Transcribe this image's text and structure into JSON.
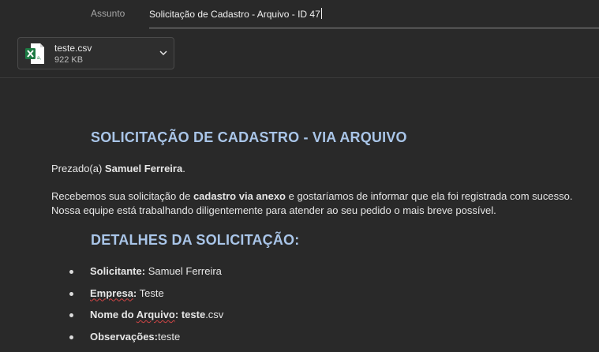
{
  "header": {
    "subject_label": "Assunto",
    "subject_value": "Solicitação de Cadastro - Arquivo - ID 47"
  },
  "attachment": {
    "name": "teste.csv",
    "size": "922 KB",
    "icon": "excel-csv-icon"
  },
  "email": {
    "title": "SOLICITAÇÃO DE CADASTRO - VIA ARQUIVO",
    "greeting_prefix": "Prezado(a) ",
    "greeting_name": "Samuel Ferreira",
    "greeting_suffix": ".",
    "body_line1_a": "Recebemos sua solicitação de ",
    "body_line1_bold": "cadastro via anexo",
    "body_line1_b": " e gostaríamos de informar que ela foi registrada com sucesso.",
    "body_line2": "Nossa equipe está trabalhando diligentemente para atender ao seu pedido o mais breve possível.",
    "details_title": "DETALHES DA SOLICITAÇÃO:",
    "details": {
      "solicitante_label": "Solicitante:",
      "solicitante_value": " Samuel Ferreira",
      "empresa_label_main": "Empresa",
      "empresa_label_colon": ":",
      "empresa_value": " Teste",
      "arquivo_label_a": "Nome do ",
      "arquivo_label_b": "Arquivo",
      "arquivo_label_colon": ":",
      "arquivo_value_bold": " teste",
      "arquivo_value_ext": ".csv",
      "observacoes_label": "Observações:",
      "observacoes_value": "teste"
    }
  }
}
